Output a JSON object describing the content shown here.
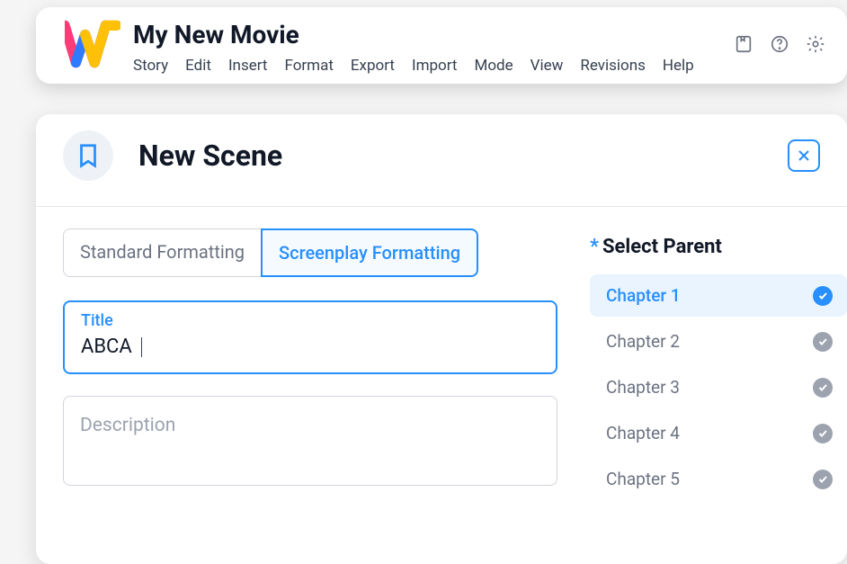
{
  "header": {
    "doc_title": "My New Movie",
    "menu": [
      "Story",
      "Edit",
      "Insert",
      "Format",
      "Export",
      "Import",
      "Mode",
      "View",
      "Revisions",
      "Help"
    ]
  },
  "panel": {
    "title": "New Scene",
    "tabs": {
      "standard": "Standard Formatting",
      "screenplay": "Screenplay Formatting"
    },
    "title_field": {
      "label": "Title",
      "value": "ABCA"
    },
    "description_placeholder": "Description",
    "parent": {
      "label": "Select Parent",
      "items": [
        {
          "label": "Chapter 1",
          "selected": true
        },
        {
          "label": "Chapter 2",
          "selected": false
        },
        {
          "label": "Chapter 3",
          "selected": false
        },
        {
          "label": "Chapter 4",
          "selected": false
        },
        {
          "label": "Chapter 5",
          "selected": false
        }
      ]
    }
  }
}
